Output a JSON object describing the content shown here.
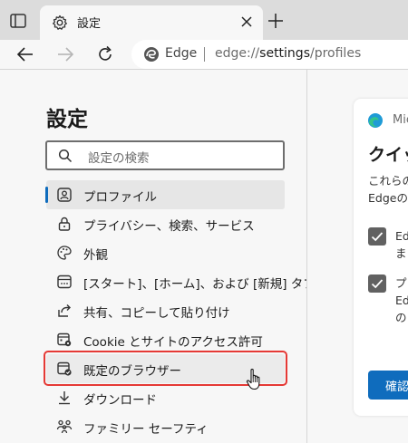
{
  "tab": {
    "title": "設定"
  },
  "address": {
    "brand": "Edge",
    "url_prefix": "edge://",
    "url_main": "settings",
    "url_suffix": "/profiles"
  },
  "sidebar": {
    "title": "設定",
    "search_placeholder": "設定の検索",
    "items": [
      {
        "label": "プロファイル",
        "icon": "profile-icon"
      },
      {
        "label": "プライバシー、検索、サービス",
        "icon": "lock-icon"
      },
      {
        "label": "外観",
        "icon": "palette-icon"
      },
      {
        "label": "[スタート]、[ホーム]、および [新規] タブ",
        "icon": "start-page-icon"
      },
      {
        "label": "共有、コピーして貼り付け",
        "icon": "share-icon"
      },
      {
        "label": "Cookie とサイトのアクセス許可",
        "icon": "site-permissions-icon"
      },
      {
        "label": "既定のブラウザー",
        "icon": "default-browser-icon"
      },
      {
        "label": "ダウンロード",
        "icon": "download-icon"
      },
      {
        "label": "ファミリー セーフティ",
        "icon": "family-icon"
      }
    ]
  },
  "card": {
    "brand": "Mic",
    "title": "クイッ",
    "desc_lines": [
      "これらの",
      "Edgeの"
    ],
    "check1_lines": [
      "Ed",
      "ま"
    ],
    "check2_lines": [
      "プ",
      "Ed",
      "の"
    ],
    "confirm_label": "確認"
  },
  "colors": {
    "accent": "#0f6cbd",
    "highlight": "#e53935"
  }
}
